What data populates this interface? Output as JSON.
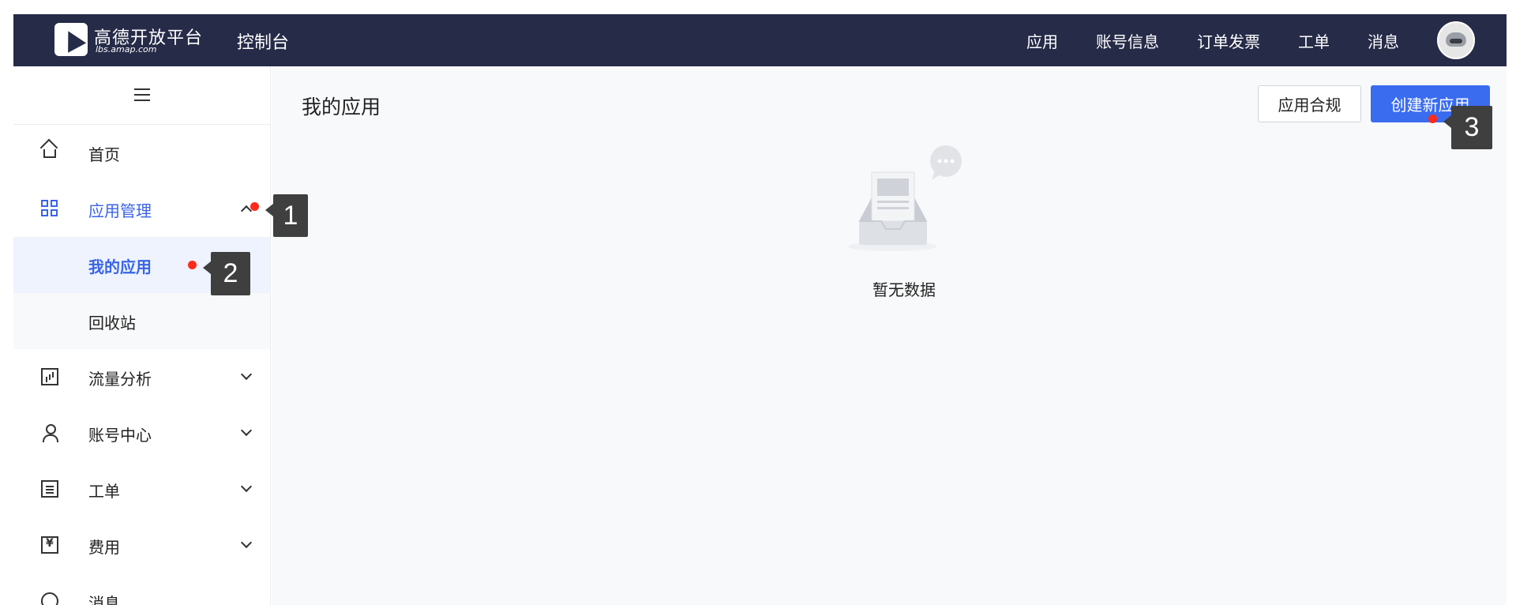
{
  "header": {
    "logo_name": "高德开放平台",
    "logo_sub": "lbs.amap.com",
    "console_title": "控制台",
    "nav": [
      "应用",
      "账号信息",
      "订单发票",
      "工单",
      "消息"
    ]
  },
  "sidebar": {
    "items": [
      {
        "label": "首页",
        "icon": "home-icon"
      },
      {
        "label": "应用管理",
        "icon": "grid-icon",
        "active": true,
        "expanded": true,
        "children": [
          {
            "label": "我的应用",
            "selected": true
          },
          {
            "label": "回收站"
          }
        ]
      },
      {
        "label": "流量分析",
        "icon": "chart-icon"
      },
      {
        "label": "账号中心",
        "icon": "user-icon"
      },
      {
        "label": "工单",
        "icon": "ticket-icon"
      },
      {
        "label": "费用",
        "icon": "fee-icon"
      },
      {
        "label": "消息",
        "icon": "message-icon"
      }
    ]
  },
  "main": {
    "title": "我的应用",
    "compliance_button": "应用合规",
    "create_button": "创建新应用",
    "empty_text": "暂无数据"
  },
  "annotations": [
    "1",
    "2",
    "3"
  ],
  "colors": {
    "header_bg": "#262b48",
    "accent": "#3a64e6",
    "primary_button": "#3a6cf0",
    "marker": "#ff2a1a"
  }
}
